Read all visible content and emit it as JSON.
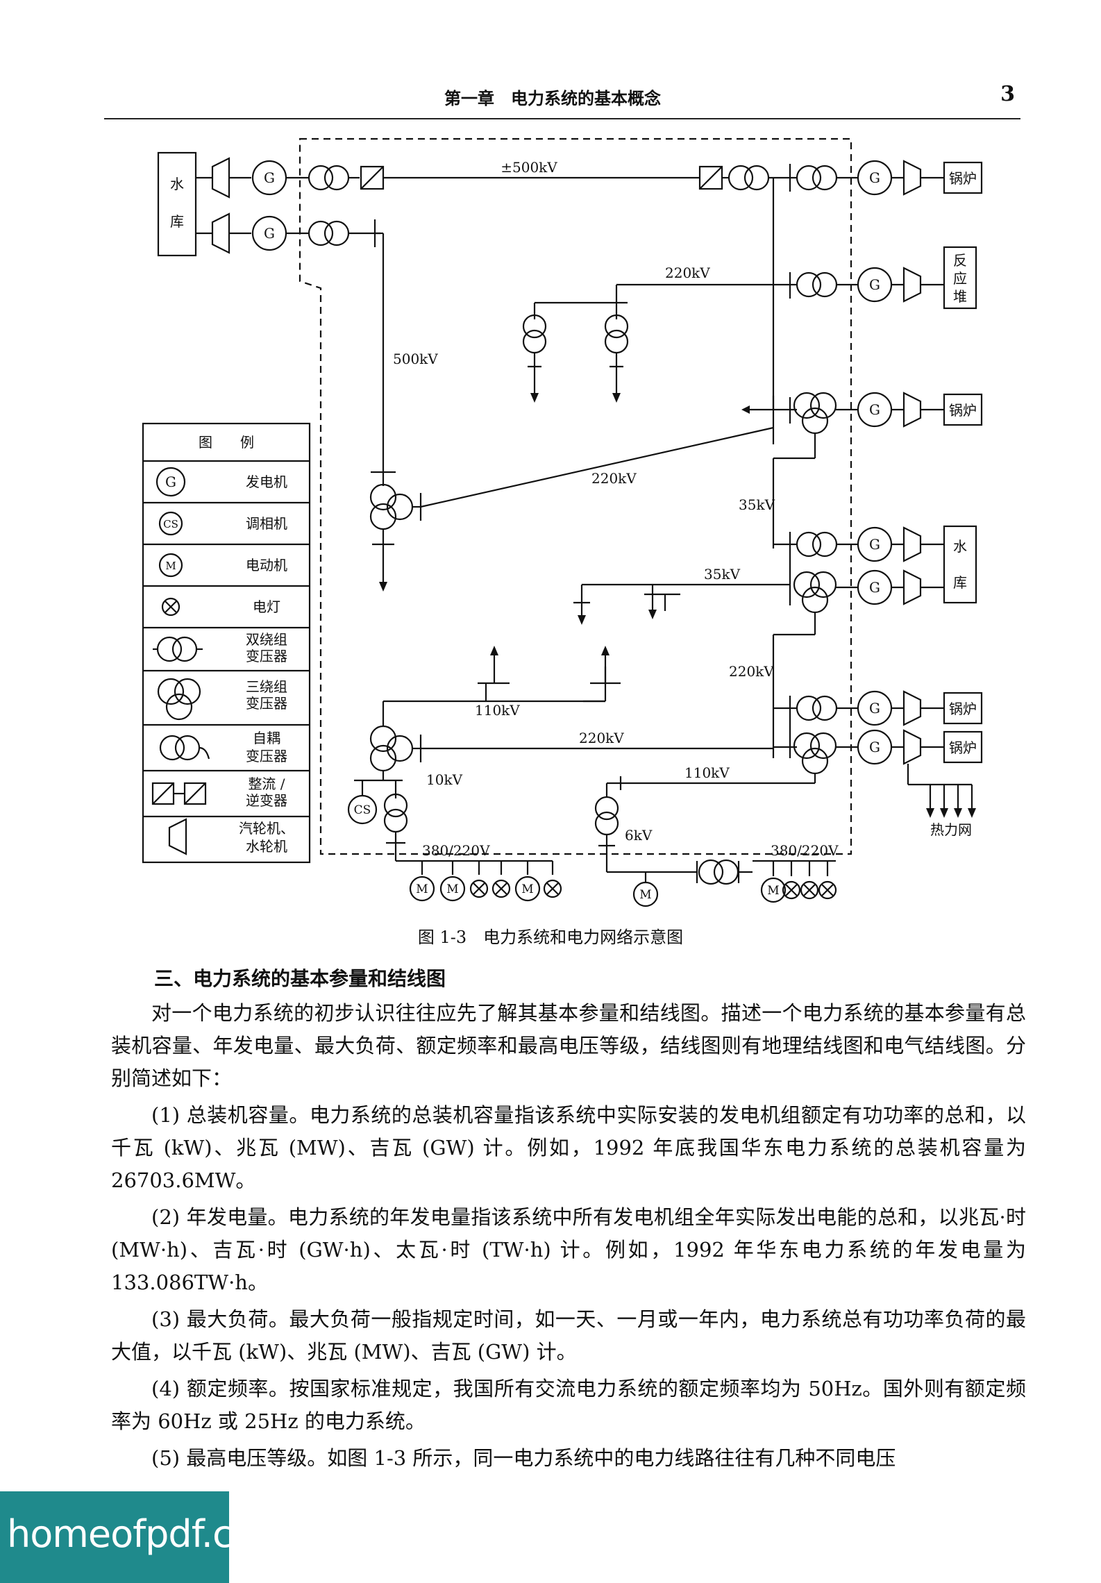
{
  "header": {
    "chapter": "第一章　电力系统的基本概念",
    "page_number": "3"
  },
  "diagram": {
    "reservoir_top": [
      "水",
      "库"
    ],
    "reservoir_right": [
      "水",
      "库"
    ],
    "boiler": "锅炉",
    "reactor": [
      "反",
      "应",
      "堆"
    ],
    "gen_symbol": "G",
    "cs_symbol": "CS",
    "m_symbol": "M",
    "heat_network": "热力网",
    "voltages": {
      "dc": "±500kV",
      "v500": "500kV",
      "v220_top": "220kV",
      "v220_diag": "220kV",
      "v35_a": "35kV",
      "v35_b": "35kV",
      "v220_c": "220kV",
      "v110_a": "110kV",
      "v220_d": "220kV",
      "v110_b": "110kV",
      "v10": "10kV",
      "v6": "6kV",
      "v380_a": "380/220V",
      "v380_b": "380/220V"
    },
    "legend": {
      "title": "图　　例",
      "items": [
        {
          "label": "发电机"
        },
        {
          "label": "调相机"
        },
        {
          "label": "电动机"
        },
        {
          "label": "电灯"
        },
        {
          "label": "双绕组变压器",
          "lines": [
            "双绕组",
            "变压器"
          ]
        },
        {
          "label": "三绕组变压器",
          "lines": [
            "三绕组",
            "变压器"
          ]
        },
        {
          "label": "自耦变压器",
          "lines": [
            "自耦",
            "变压器"
          ]
        },
        {
          "label": "整流/逆变器",
          "lines": [
            "整流 /",
            "逆变器"
          ]
        },
        {
          "label": "汽轮机、水轮机",
          "lines": [
            "汽轮机、",
            "水轮机"
          ]
        }
      ]
    }
  },
  "caption": "图 1-3　电力系统和电力网络示意图",
  "section_title": "三、电力系统的基本参量和结线图",
  "paragraphs": [
    "对一个电力系统的初步认识往往应先了解其基本参量和结线图。描述一个电力系统的基本参量有总装机容量、年发电量、最大负荷、额定频率和最高电压等级，结线图则有地理结线图和电气结线图。分别简述如下：",
    "(1) 总装机容量。电力系统的总装机容量指该系统中实际安装的发电机组额定有功功率的总和，以千瓦 (kW)、兆瓦 (MW)、吉瓦 (GW) 计。例如，1992 年底我国华东电力系统的总装机容量为 26703.6MW。",
    "(2) 年发电量。电力系统的年发电量指该系统中所有发电机组全年实际发出电能的总和，以兆瓦·时 (MW·h)、吉瓦·时 (GW·h)、太瓦·时 (TW·h) 计。例如，1992 年华东电力系统的年发电量为 133.086TW·h。",
    "(3) 最大负荷。最大负荷一般指规定时间，如一天、一月或一年内，电力系统总有功功率负荷的最大值，以千瓦 (kW)、兆瓦 (MW)、吉瓦 (GW) 计。",
    "(4) 额定频率。按国家标准规定，我国所有交流电力系统的额定频率均为 50Hz。国外则有额定频率为 60Hz 或 25Hz 的电力系统。",
    "(5) 最高电压等级。如图 1-3 所示，同一电力系统中的电力线路往往有几种不同电压"
  ],
  "watermark": "homeofpdf.com"
}
